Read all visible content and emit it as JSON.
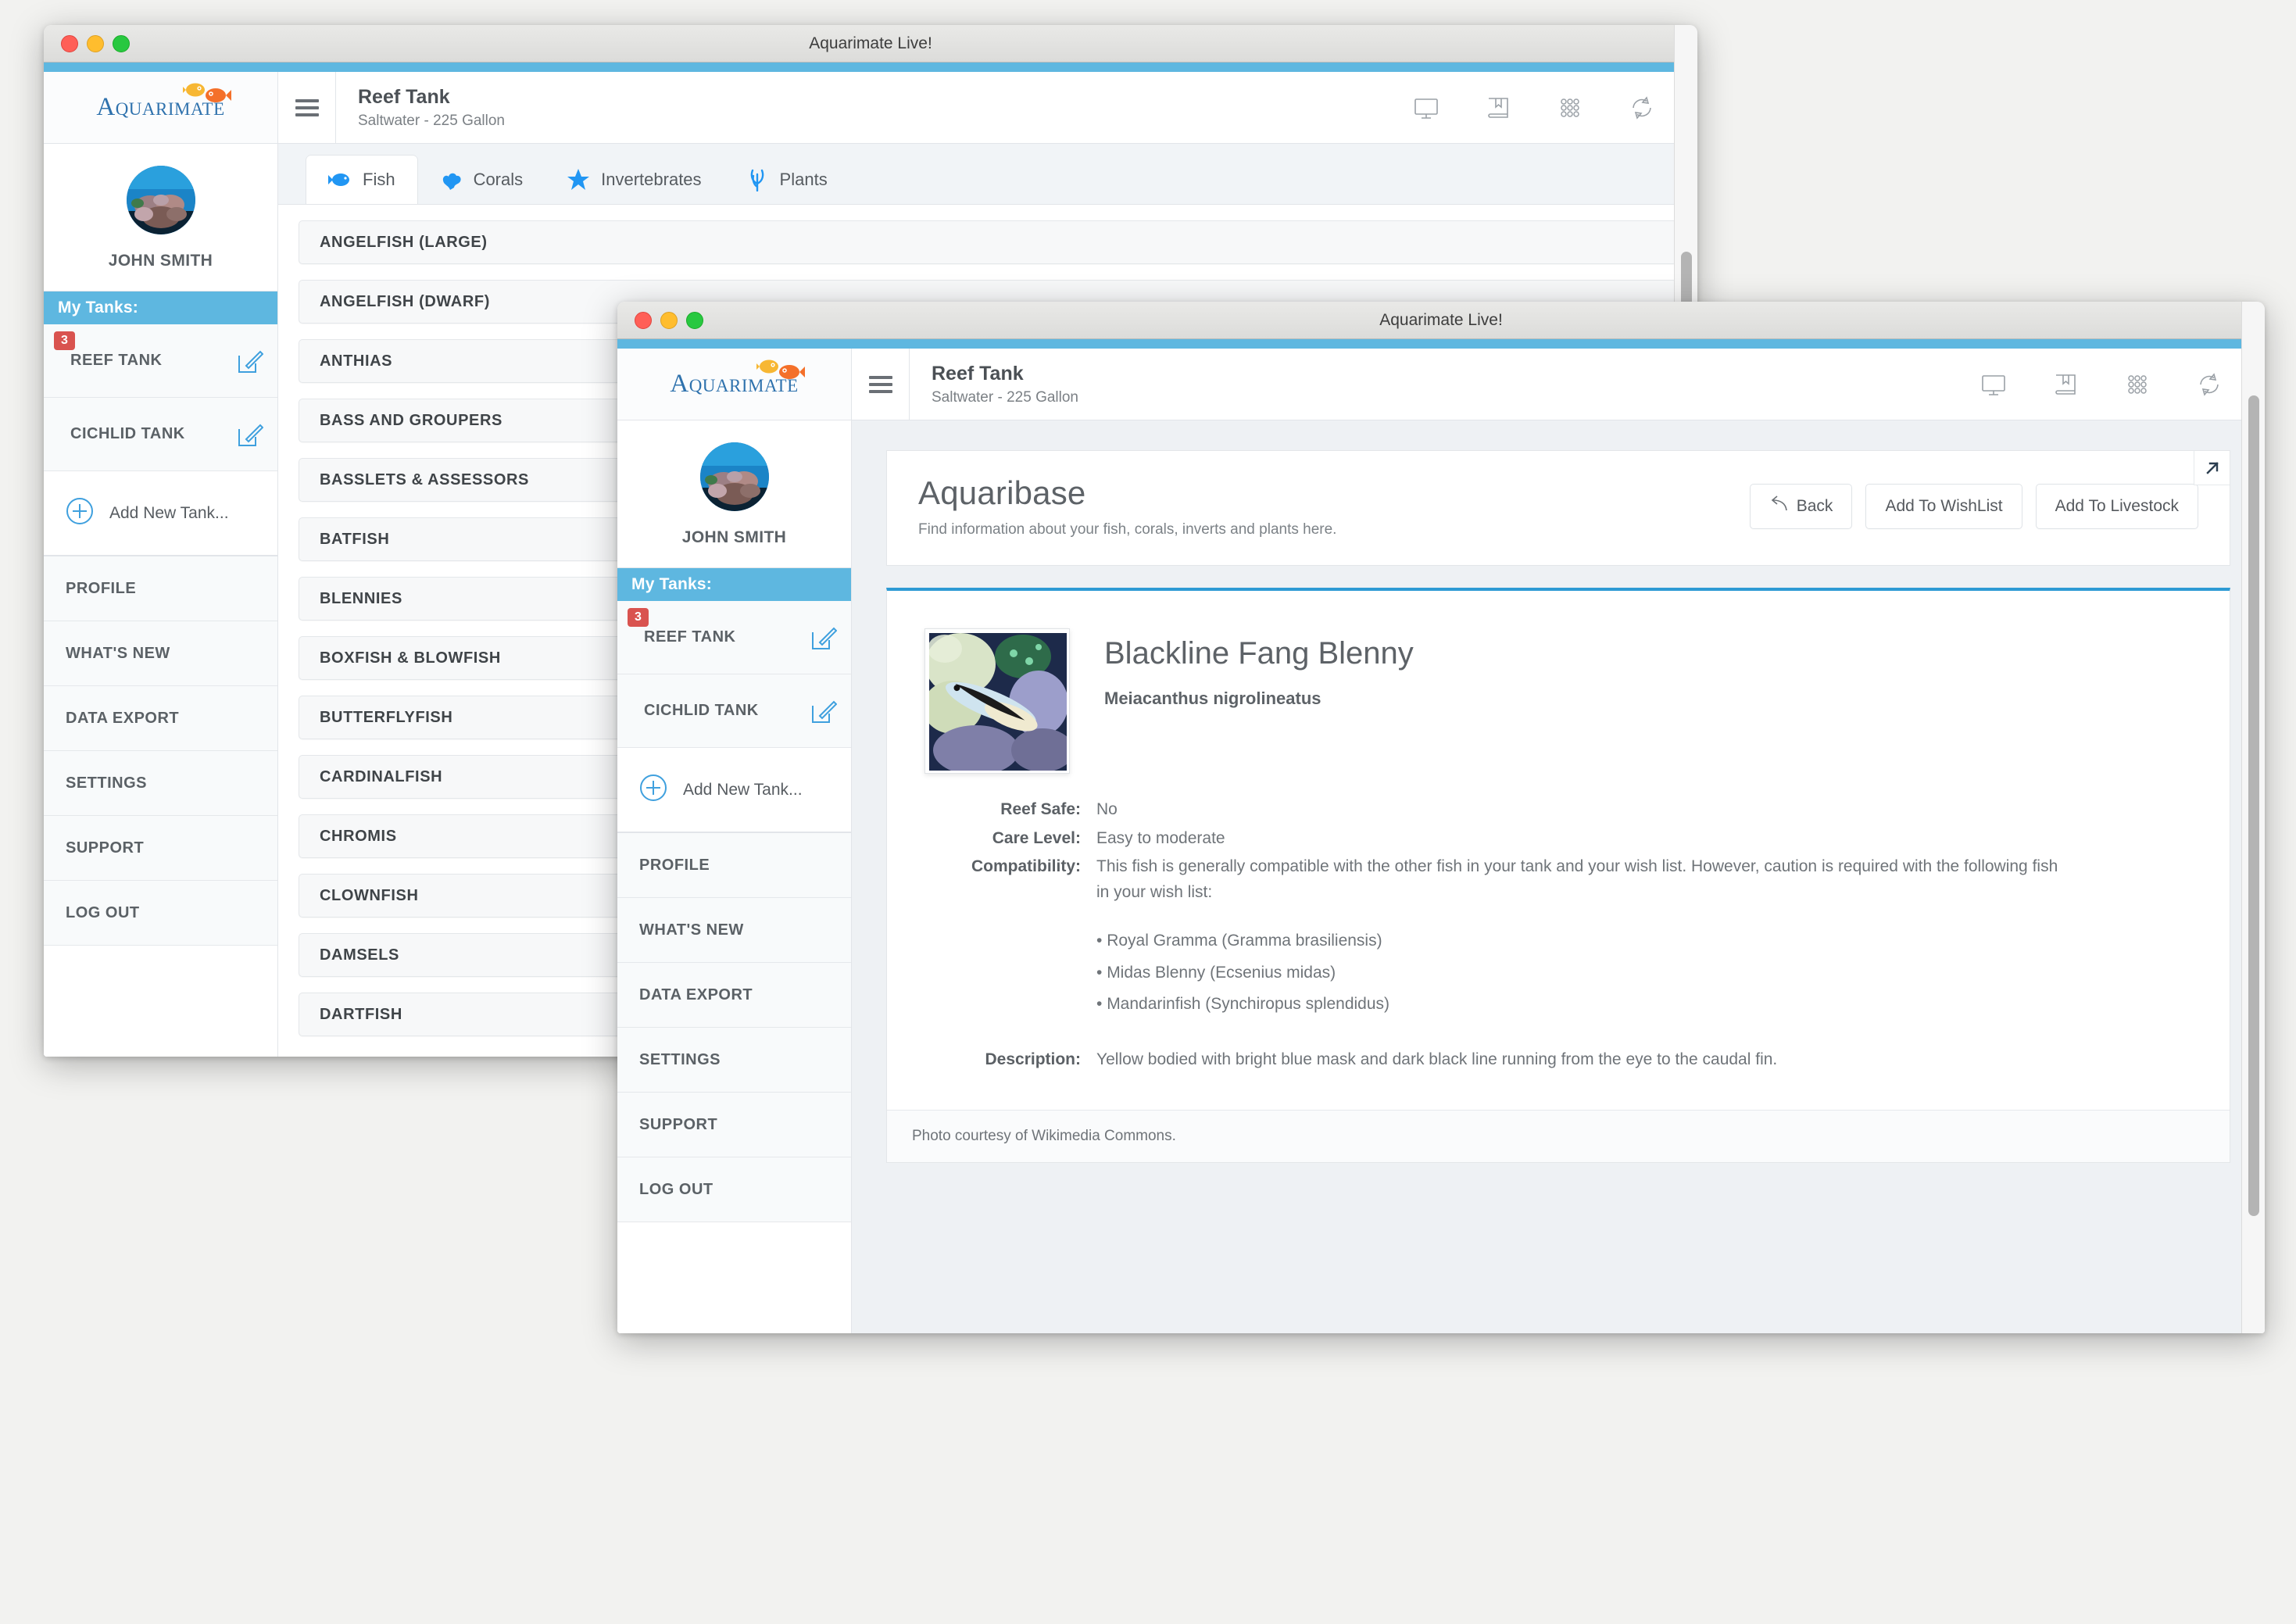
{
  "desktop": {
    "background_color": "#f2f2f0"
  },
  "background_window": {
    "titlebar": {
      "title": "Aquarimate Live!",
      "traffic_lights": [
        "close-red",
        "minimize-yellow",
        "zoom-green"
      ]
    },
    "brand": {
      "text": "Aquarimate",
      "logo_icon": "two-fish-icon"
    },
    "profile": {
      "name": "JOHN SMITH",
      "avatar_icon": "coral-reef-avatar"
    },
    "tanks_header": "My Tanks:",
    "tanks": [
      {
        "name": "REEF TANK",
        "badge": "3",
        "edit_icon": "edit-pencil-icon"
      },
      {
        "name": "CICHLID TANK",
        "badge": "",
        "edit_icon": "edit-pencil-icon"
      }
    ],
    "add_tank": {
      "label": "Add New Tank...",
      "icon": "plus-circle-icon"
    },
    "nav": [
      {
        "label": "PROFILE"
      },
      {
        "label": "WHAT'S NEW"
      },
      {
        "label": "DATA EXPORT"
      },
      {
        "label": "SETTINGS"
      },
      {
        "label": "SUPPORT"
      },
      {
        "label": "LOG OUT"
      }
    ],
    "topbar": {
      "hamburger_icon": "hamburger-menu-icon",
      "tank_title": "Reef Tank",
      "tank_subtitle": "Saltwater - 225 Gallon",
      "tools": [
        {
          "icon": "monitor-dashboard-icon"
        },
        {
          "icon": "book-aquaribase-icon"
        },
        {
          "icon": "grid-apps-icon"
        },
        {
          "icon": "sync-refresh-icon"
        }
      ]
    },
    "tabs": [
      {
        "label": "Fish",
        "icon": "fish-icon",
        "active": true
      },
      {
        "label": "Corals",
        "icon": "coral-icon",
        "active": false
      },
      {
        "label": "Invertebrates",
        "icon": "starfish-icon",
        "active": false
      },
      {
        "label": "Plants",
        "icon": "plant-icon",
        "active": false
      }
    ],
    "fish_categories": [
      "ANGELFISH (LARGE)",
      "ANGELFISH (DWARF)",
      "ANTHIAS",
      "BASS AND GROUPERS",
      "BASSLETS & ASSESSORS",
      "BATFISH",
      "BLENNIES",
      "BOXFISH & BLOWFISH",
      "BUTTERFLYFISH",
      "CARDINALFISH",
      "CHROMIS",
      "CLOWNFISH",
      "DAMSELS",
      "DARTFISH"
    ]
  },
  "foreground_window": {
    "titlebar": {
      "title": "Aquarimate Live!",
      "traffic_lights": [
        "close-red",
        "minimize-yellow",
        "zoom-green"
      ]
    },
    "brand": {
      "text": "Aquarimate",
      "logo_icon": "two-fish-icon"
    },
    "profile": {
      "name": "JOHN SMITH",
      "avatar_icon": "coral-reef-avatar"
    },
    "tanks_header": "My Tanks:",
    "tanks": [
      {
        "name": "REEF TANK",
        "badge": "3",
        "edit_icon": "edit-pencil-icon"
      },
      {
        "name": "CICHLID TANK",
        "badge": "",
        "edit_icon": "edit-pencil-icon"
      }
    ],
    "add_tank": {
      "label": "Add New Tank...",
      "icon": "plus-circle-icon"
    },
    "nav": [
      {
        "label": "PROFILE"
      },
      {
        "label": "WHAT'S NEW"
      },
      {
        "label": "DATA EXPORT"
      },
      {
        "label": "SETTINGS"
      },
      {
        "label": "SUPPORT"
      },
      {
        "label": "LOG OUT"
      }
    ],
    "topbar": {
      "hamburger_icon": "hamburger-menu-icon",
      "tank_title": "Reef Tank",
      "tank_subtitle": "Saltwater - 225 Gallon",
      "tools": [
        {
          "icon": "monitor-dashboard-icon"
        },
        {
          "icon": "book-aquaribase-icon"
        },
        {
          "icon": "grid-apps-icon"
        },
        {
          "icon": "sync-refresh-icon"
        }
      ]
    },
    "aquaribase": {
      "title": "Aquaribase",
      "subtitle": "Find information about your fish, corals, inverts and plants here.",
      "expand_icon": "expand-arrow-icon",
      "buttons": {
        "back": "Back",
        "back_icon": "back-arrow-icon",
        "wishlist": "Add To WishList",
        "livestock": "Add To Livestock"
      }
    },
    "species": {
      "photo_icon": "blenny-photo",
      "common_name": "Blackline Fang Blenny",
      "latin_name": "Meiacanthus nigrolineatus",
      "attributes": [
        {
          "label": "Reef Safe:",
          "value": "No"
        },
        {
          "label": "Care Level:",
          "value": "Easy to moderate"
        },
        {
          "label": "Compatibility:",
          "value": "This fish is generally compatible with the other fish in your tank and your wish list. However, caution is required with the following fish in your wish list:",
          "list": [
            "Royal Gramma (Gramma brasiliensis)",
            "Midas Blenny (Ecsenius midas)",
            "Mandarinfish (Synchiropus splendidus)"
          ]
        },
        {
          "label": "Description:",
          "value": "Yellow bodied with bright blue mask and dark black line running from the eye to the caudal fin."
        }
      ],
      "photo_credit": "Photo courtesy of Wikimedia Commons."
    }
  },
  "colors": {
    "accent_blue": "#5eb7e0",
    "brand_blue": "#2f72ad",
    "badge_red": "#d9534f",
    "panel_border_blue": "#2d9ad4",
    "text_dark": "#4b5055",
    "text_muted": "#7b8085"
  }
}
